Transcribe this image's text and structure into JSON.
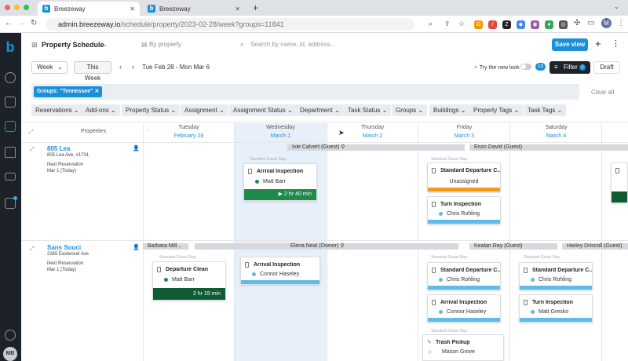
{
  "browser": {
    "tabs": [
      {
        "label": "Breezeway"
      },
      {
        "label": "Breezeway"
      }
    ],
    "url_main": "admin.breezeway.io",
    "url_path": "/schedule/property/2023-02-28/week?groups=11841",
    "profile": "M"
  },
  "sidebar": {
    "user_initials": "MB"
  },
  "header": {
    "title": "Property Schedule",
    "by_property": "By property",
    "search_placeholder": "Search by name, id, address...",
    "save_view": "Save view"
  },
  "toolbar": {
    "range": "Week",
    "this_week": "This Week",
    "date_range": "Tue Feb 28 - Mon Mar 6",
    "try_new_look": "Try the new look",
    "new_look_badge": "13",
    "filter": "Filter",
    "filter_count": "1",
    "draft": "Draft"
  },
  "groups_chip": "Groups: \"Tennessee\"",
  "clear_all": "Clear all",
  "filters": [
    "Reservations",
    "Add-ons",
    "Property Status",
    "Assignment",
    "Assignment Status",
    "Department",
    "Task Status",
    "Groups",
    "Buildings",
    "Property Tags",
    "Task Tags"
  ],
  "grid": {
    "properties_header": "Properties",
    "days": [
      {
        "name": "Tuesday",
        "date": "February 28"
      },
      {
        "name": "Wednesday",
        "date": "March 1"
      },
      {
        "name": "Thursday",
        "date": "March 2"
      },
      {
        "name": "Friday",
        "date": "March 3"
      },
      {
        "name": "Saturday",
        "date": "March 4"
      }
    ],
    "properties": [
      {
        "name": "805 Lea",
        "address": "805 Lea Ave, #1701",
        "next_label": "Next Reservation",
        "next_date": "Mar 1 (Today)"
      },
      {
        "name": "Sans Souci",
        "address": "2365 Eastwood Ave",
        "next_label": "Next Reservation",
        "next_date": "Mar 1 (Today)"
      }
    ],
    "stays": {
      "ivie": "Ivie Calvert (Guest)",
      "enzo": "Enzo David (Guest)",
      "barbara": "Barbara Mill...",
      "elena": "Elena Neal (Owner)",
      "kealan": "Kealan Ray (Guest)",
      "harley": "Harley Driscoll (Guest)"
    },
    "stay_label": "Standard Guest Stay",
    "cards": {
      "c1": {
        "title": "Arrival Inspection",
        "who": "Matt Barr",
        "time": "2 hr 40 min"
      },
      "c2": {
        "title": "Standard Departure C...",
        "who": "Unassigned"
      },
      "c3": {
        "title": "Turn Inspection",
        "who": "Chris Rohling"
      },
      "c4": {
        "title": "Departure Clean",
        "who": "Matt Barr",
        "time": "2 hr 15 min"
      },
      "c5": {
        "title": "Arrival Inspection",
        "who": "Connor Haseley"
      },
      "c6": {
        "title": "Standard Departure C...",
        "who": "Chris Rohling"
      },
      "c7": {
        "title": "Arrival Inspection",
        "who": "Connor Haseley"
      },
      "c8": {
        "title": "Trash Pickup",
        "who": "Mason Grove"
      },
      "c9": {
        "title": "Standard Departure C...",
        "who": "Chris Rohling"
      },
      "c10": {
        "title": "Turn Inspection",
        "who": "Matt Gresko"
      }
    }
  },
  "colors": {
    "accent": "#1c8fd9",
    "green": "#1e8a4c",
    "darkgreen": "#0f5c34",
    "orange": "#f39a1e",
    "lightblue": "#5bbde8"
  }
}
